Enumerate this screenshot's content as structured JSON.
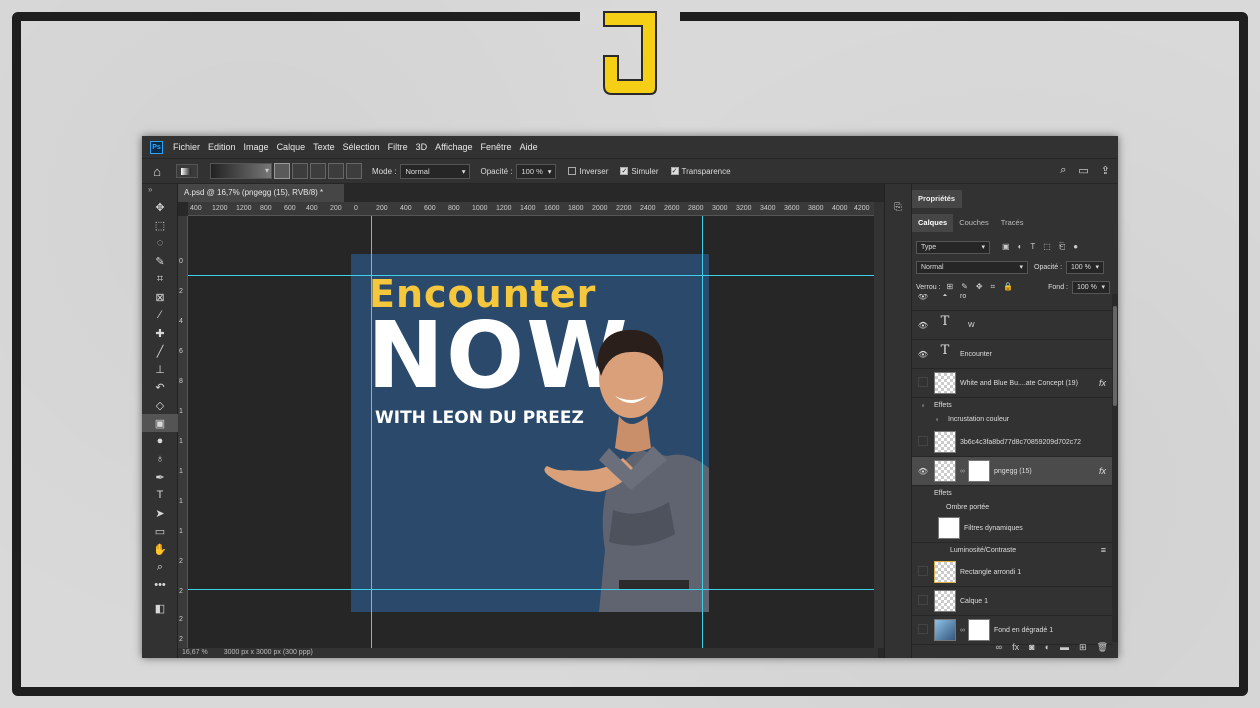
{
  "menu": {
    "badge": "Ps",
    "items": [
      "Fichier",
      "Edition",
      "Image",
      "Calque",
      "Texte",
      "Sélection",
      "Filtre",
      "3D",
      "Affichage",
      "Fenêtre",
      "Aide"
    ]
  },
  "options": {
    "mode_label": "Mode :",
    "mode_value": "Normal",
    "opacity_label": "Opacité :",
    "opacity_value": "100 %",
    "inverser": "Inverser",
    "simuler": "Simuler",
    "transparence": "Transparence"
  },
  "document": {
    "tab_title": "A.psd @ 16,7% (pngegg (15), RVB/8) *",
    "status_zoom": "16,67 %",
    "status_size": "3000 px x 3000 px (300 ppp)"
  },
  "ruler": {
    "h_ticks": [
      "400",
      "1200",
      "1200",
      "800",
      "600",
      "400",
      "200",
      "0",
      "200",
      "400",
      "600",
      "800",
      "1000",
      "1200",
      "1400",
      "1600",
      "1800",
      "2000",
      "2200",
      "2400",
      "2600",
      "2800",
      "3000",
      "3200",
      "3400",
      "3600",
      "3800",
      "4000",
      "4200"
    ],
    "v_ticks": [
      "0",
      "2",
      "4",
      "6",
      "8",
      "1",
      "1",
      "1",
      "1",
      "1",
      "2",
      "2",
      "2",
      "2"
    ]
  },
  "artwork": {
    "line1": "Encounter",
    "line2": "NOW",
    "line3": "WITH LEON DU PREEZ"
  },
  "panel": {
    "properties_tab": "Propriétés",
    "tabs": [
      "Calques",
      "Couches",
      "Tracés"
    ],
    "filter_type": "Type",
    "blend_mode": "Normal",
    "opacity_label": "Opacité :",
    "opacity_value": "100 %",
    "lock_label": "Verrou :",
    "fill_label": "Fond :",
    "fill_value": "100 %",
    "layers": {
      "l_top": "ro",
      "l_w": "W",
      "l_encounter": "Encounter",
      "l_concept": "White and Blue Bu....ate Concept (19)",
      "l_effets1": "Effets",
      "l_incrust": "Incrustation couleur",
      "l_hash": "3b6c4c3fa8bd77d8c70859209d702c72",
      "l_pngegg": "pngegg (15)",
      "l_effets2": "Effets",
      "l_ombre": "Ombre portée",
      "l_filtres": "Filtres dynamiques",
      "l_lumi": "Luminosité/Contraste",
      "l_rect": "Rectangle arrondi 1",
      "l_calque": "Calque 1",
      "l_fond": "Fond en dégradé 1"
    }
  },
  "colors": {
    "accent_yellow": "#f4c73c",
    "artboard_blue": "#2b4a6b",
    "guide": "#3fd0e8"
  }
}
